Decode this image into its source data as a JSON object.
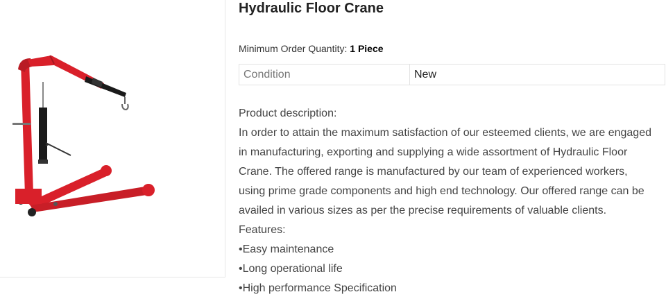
{
  "product": {
    "image_icon": "hydraulic-floor-crane-photo",
    "title": "Hydraulic Floor Crane",
    "moq_label": "Minimum Order Quantity:",
    "moq_value": "1 Piece",
    "specs": [
      {
        "key": "Condition",
        "value": "New"
      }
    ],
    "description_heading": "Product description:",
    "description_lines": [
      "In order to attain the maximum satisfaction of our esteemed clients, we are engaged",
      "in manufacturing, exporting and supplying a wide assortment of Hydraulic Floor",
      "Crane. The offered range is manufactured by our team of experienced workers,",
      "using prime grade components and high end technology. Our offered range can be",
      "availed in various sizes as per the precise requirements of valuable clients."
    ],
    "features_heading": "Features:",
    "features": [
      "Easy maintenance",
      "Long operational life",
      "High performance Specification"
    ],
    "colors": {
      "crane_red": "#d9202a",
      "cylinder_black": "#1a1a1a"
    }
  }
}
